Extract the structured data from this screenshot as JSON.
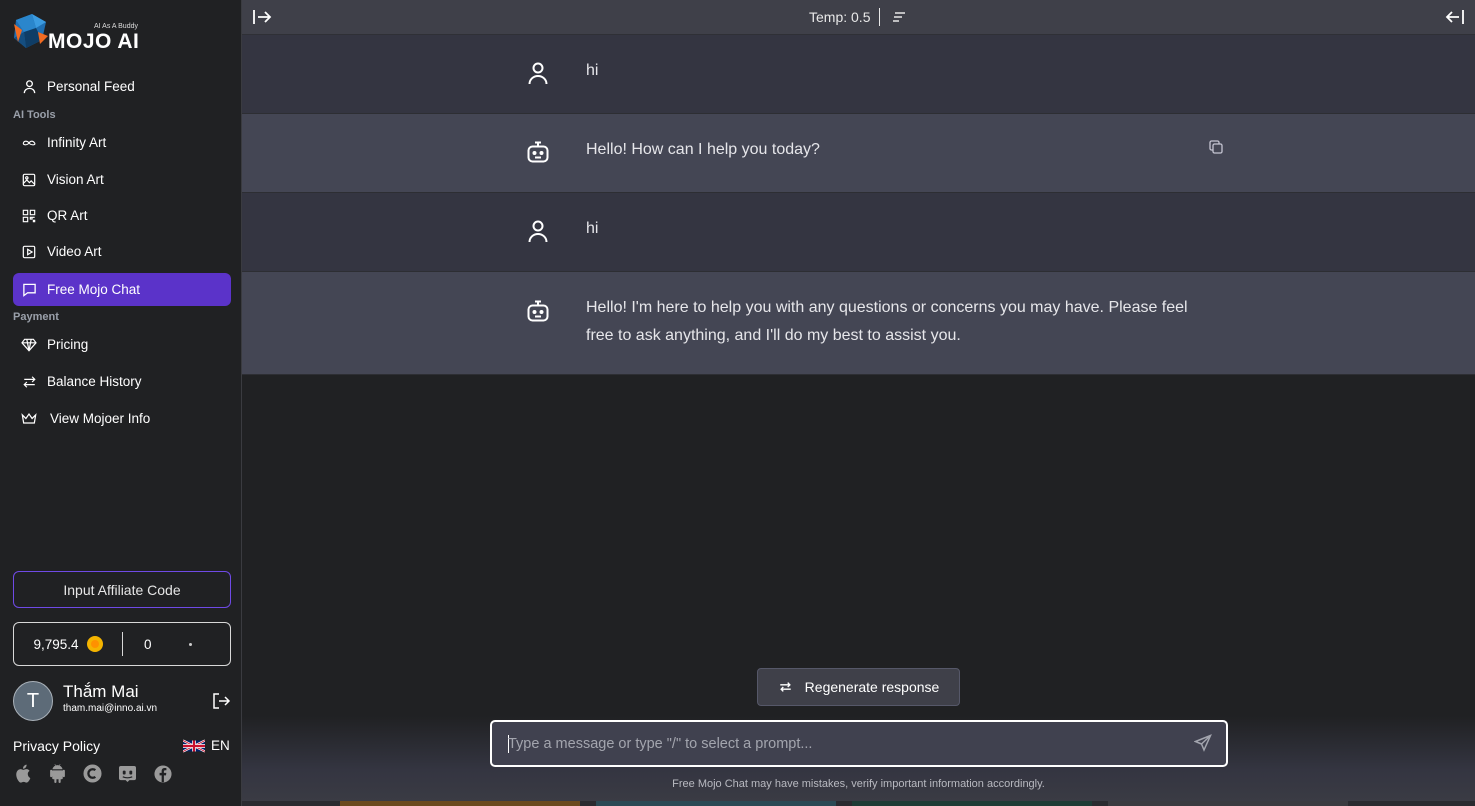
{
  "brand": {
    "name": "MOJO AI",
    "tagline": "AI As A Buddy"
  },
  "sidebar": {
    "personal_feed": "Personal Feed",
    "section_ai_tools": "AI Tools",
    "items": [
      {
        "label": "Infinity Art",
        "icon": "infinity-icon"
      },
      {
        "label": "Vision Art",
        "icon": "image-icon"
      },
      {
        "label": "QR Art",
        "icon": "qr-icon"
      },
      {
        "label": "Video Art",
        "icon": "video-icon"
      },
      {
        "label": "Free Mojo Chat",
        "icon": "chat-icon",
        "active": true
      }
    ],
    "section_payment": "Payment",
    "payment_items": [
      {
        "label": "Pricing",
        "icon": "diamond-icon"
      },
      {
        "label": "Balance History",
        "icon": "swap-icon"
      },
      {
        "label": "View Mojoer Info",
        "icon": "crown-icon"
      }
    ],
    "affiliate_button": "Input Affiliate Code",
    "balance": {
      "coins": "9,795.4",
      "other": "0"
    },
    "user": {
      "initial": "T",
      "name": "Thắm Mai",
      "email": "tham.mai@inno.ai.vn"
    },
    "privacy": "Privacy Policy",
    "language": "EN",
    "socials": [
      "apple-icon",
      "android-icon",
      "copyright-c-icon",
      "discord-icon",
      "facebook-icon"
    ]
  },
  "topbar": {
    "temp": "Temp: 0.5"
  },
  "messages": [
    {
      "role": "user",
      "text": "hi"
    },
    {
      "role": "bot",
      "text": "Hello! How can I help you today?"
    },
    {
      "role": "user",
      "text": "hi"
    },
    {
      "role": "bot",
      "text": "Hello! I'm here to help you with any questions or concerns you may have. Please feel free to ask anything, and I'll do my best to assist you."
    }
  ],
  "regenerate_label": "Regenerate response",
  "input": {
    "placeholder": "Type a message or type \"/\" to select a prompt...",
    "value": ""
  },
  "disclaimer": "Free Mojo Chat may have mistakes, verify important information accordingly.",
  "colors": {
    "accent": "#5b33c9",
    "sidebar_bg": "#202123",
    "user_msg_bg": "#343541",
    "bot_msg_bg": "#444654"
  }
}
